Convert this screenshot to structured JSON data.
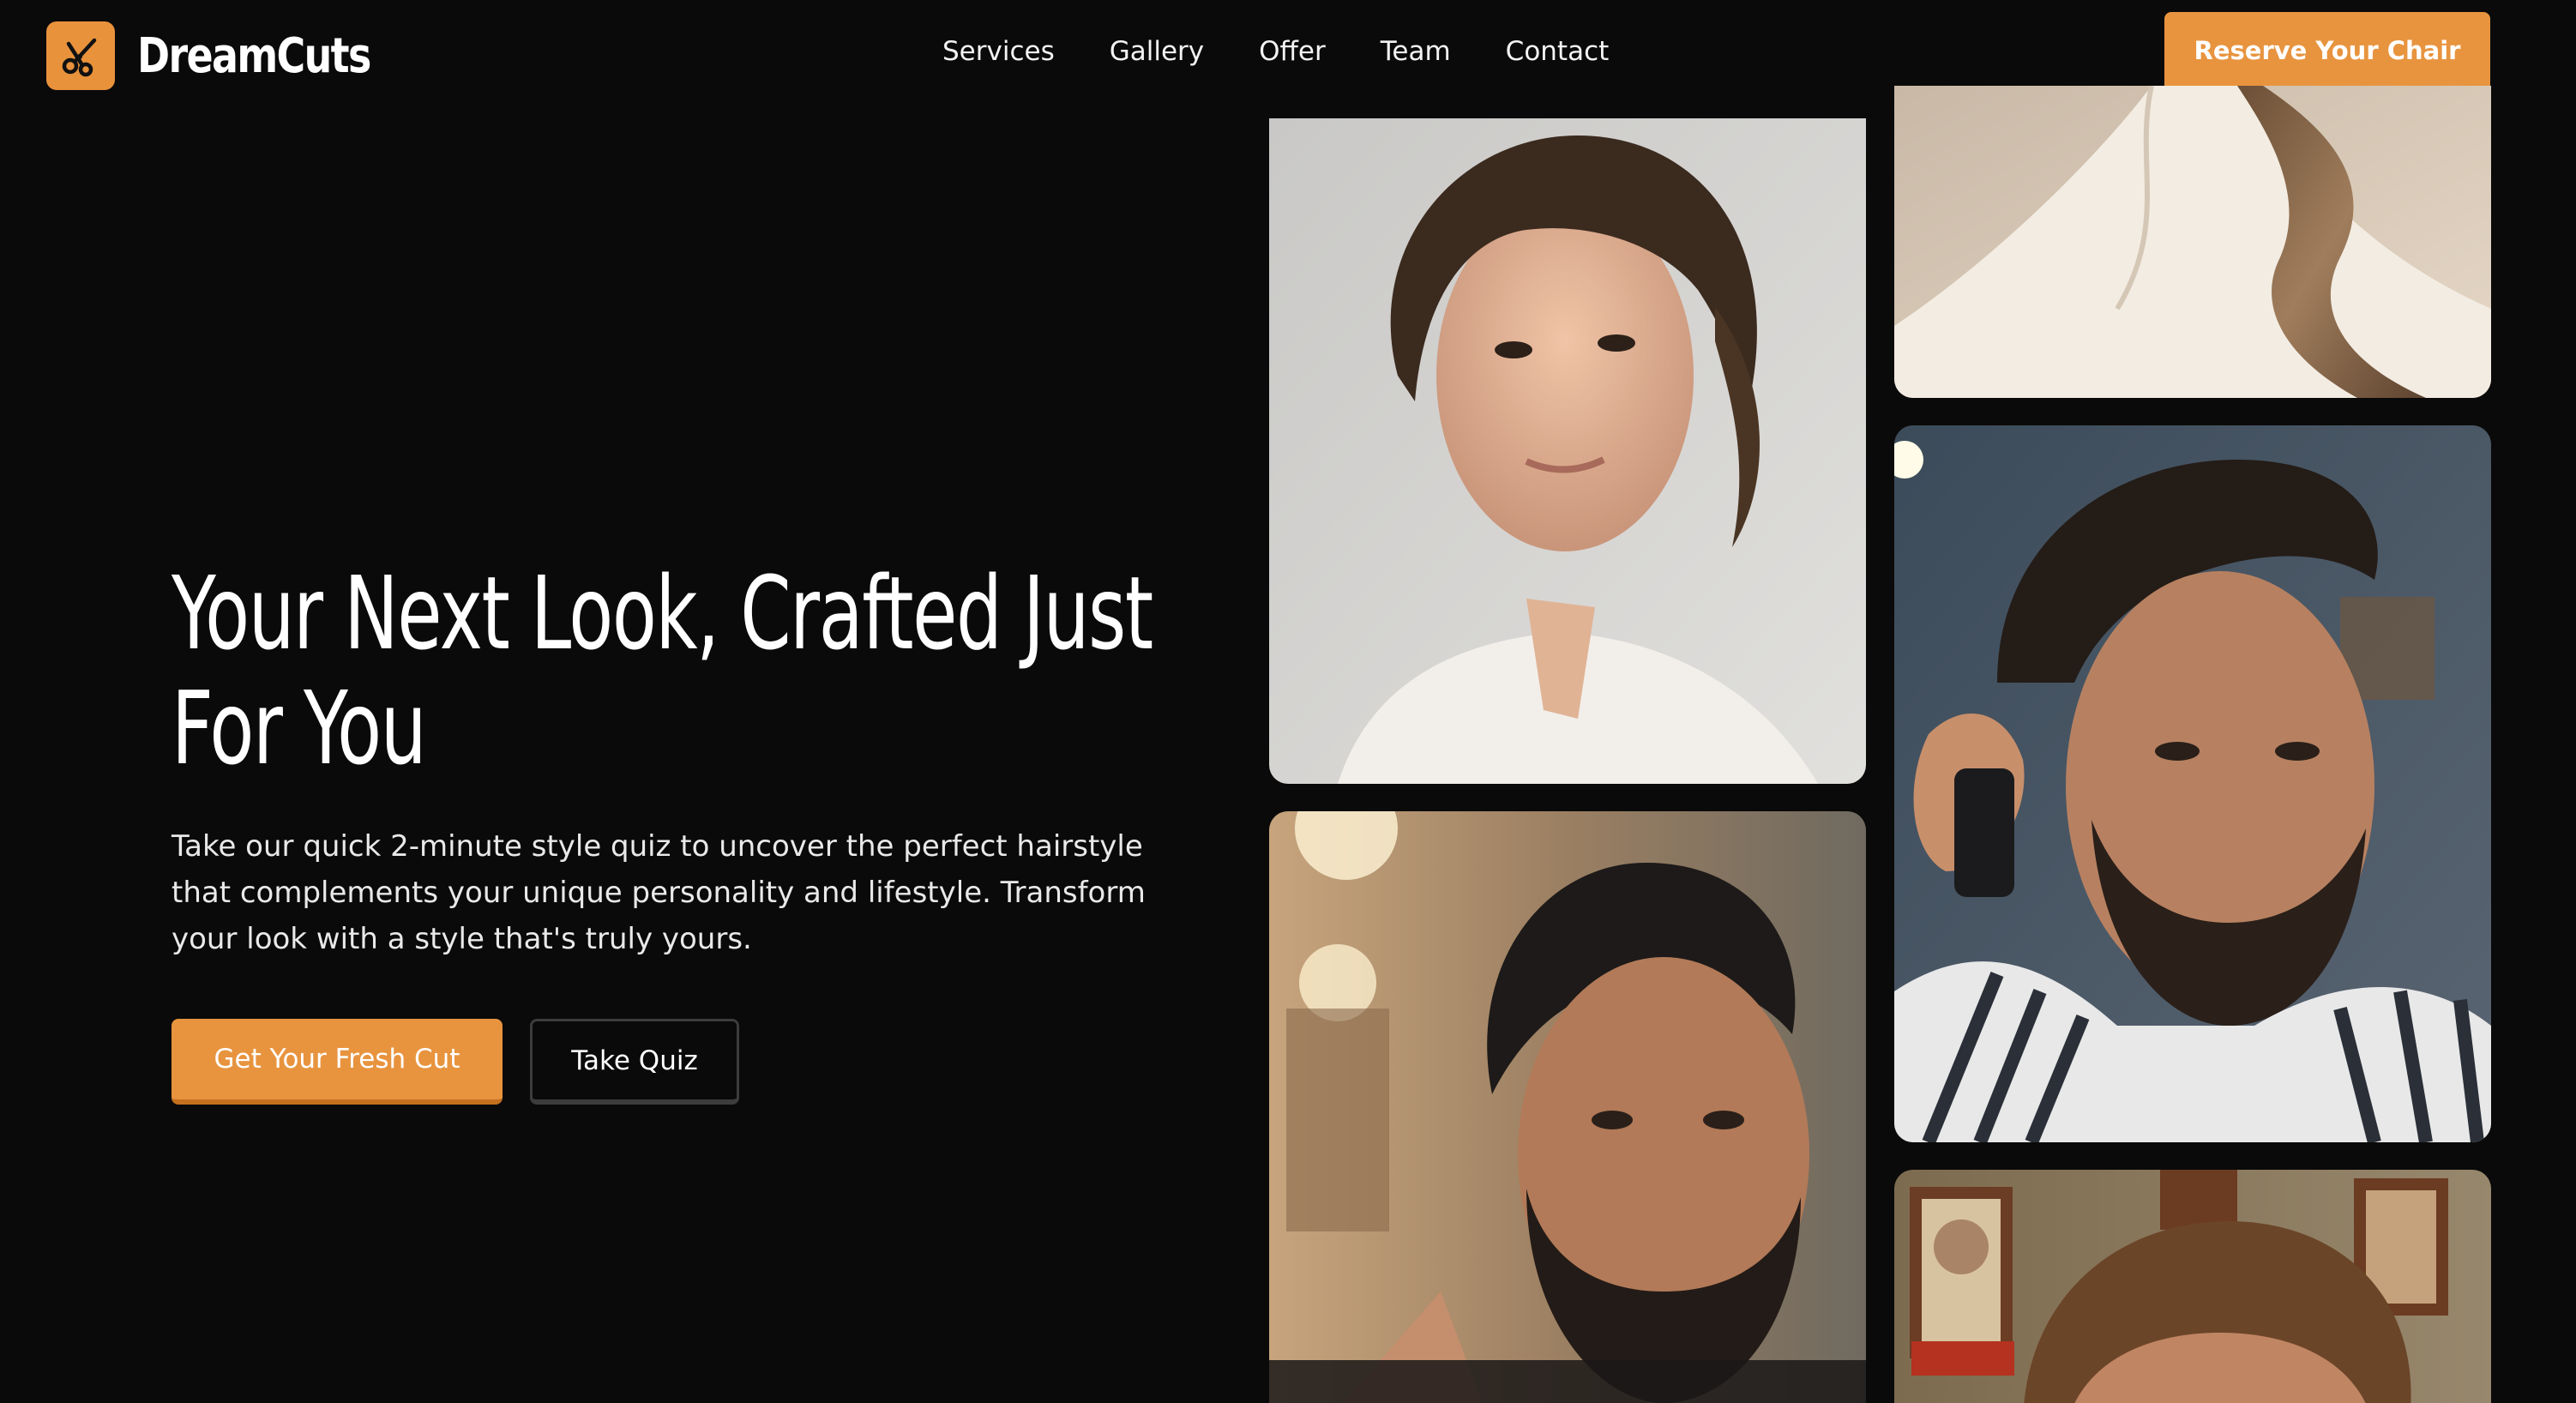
{
  "brand": {
    "name": "DreamCuts",
    "logo_icon": "scissors-icon",
    "accent_color": "#e8943f"
  },
  "nav": {
    "items": [
      "Services",
      "Gallery",
      "Offer",
      "Team",
      "Contact"
    ],
    "cta_label": "Reserve Your Chair"
  },
  "hero": {
    "title": "Your Next Look, Crafted Just For You",
    "subtitle": "Take our quick 2-minute style quiz to uncover the perfect hairstyle that complements your unique personality and lifestyle. Transform your look with a style that's truly yours.",
    "primary_button": "Get Your Fresh Cut",
    "secondary_button": "Take Quiz"
  },
  "gallery": {
    "images": [
      "wavy-hair-portrait-photo",
      "fade-beard-barber-photo",
      "flowing-hair-collar-photo",
      "pompadour-fade-barber-photo",
      "textured-hair-barbershop-photo"
    ]
  }
}
